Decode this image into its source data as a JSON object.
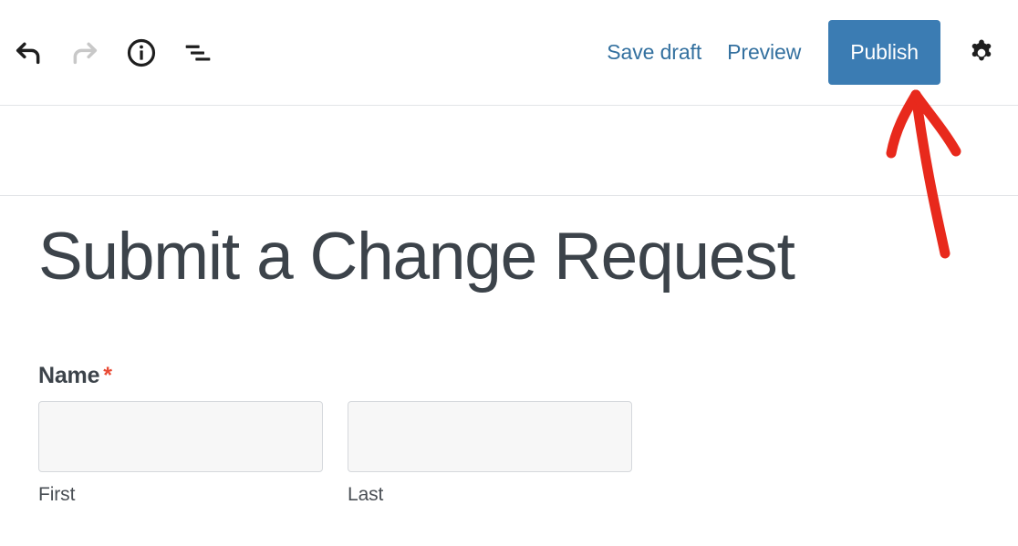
{
  "toolbar": {
    "left_tools": [
      {
        "name": "undo-icon",
        "label": "Undo",
        "state": "enabled"
      },
      {
        "name": "redo-icon",
        "label": "Redo",
        "state": "disabled"
      },
      {
        "name": "info-icon",
        "label": "Details"
      },
      {
        "name": "list-view-icon",
        "label": "List view"
      }
    ],
    "save_draft_label": "Save draft",
    "preview_label": "Preview",
    "publish_label": "Publish",
    "settings_label": "Settings",
    "settings_icon": "gear-icon",
    "publish_button_color": "#3b7cb3",
    "link_color": "#33709f"
  },
  "editor": {
    "post_title": "Submit a Change Request"
  },
  "form": {
    "name_field": {
      "label": "Name",
      "required_marker": "*",
      "required_color": "#e94b35",
      "first": {
        "value": "",
        "placeholder": "",
        "sublabel": "First"
      },
      "last": {
        "value": "",
        "placeholder": "",
        "sublabel": "Last"
      }
    }
  },
  "annotation": {
    "type": "hand-drawn-arrow",
    "color": "#e8291c",
    "points_to": "publish-button"
  }
}
